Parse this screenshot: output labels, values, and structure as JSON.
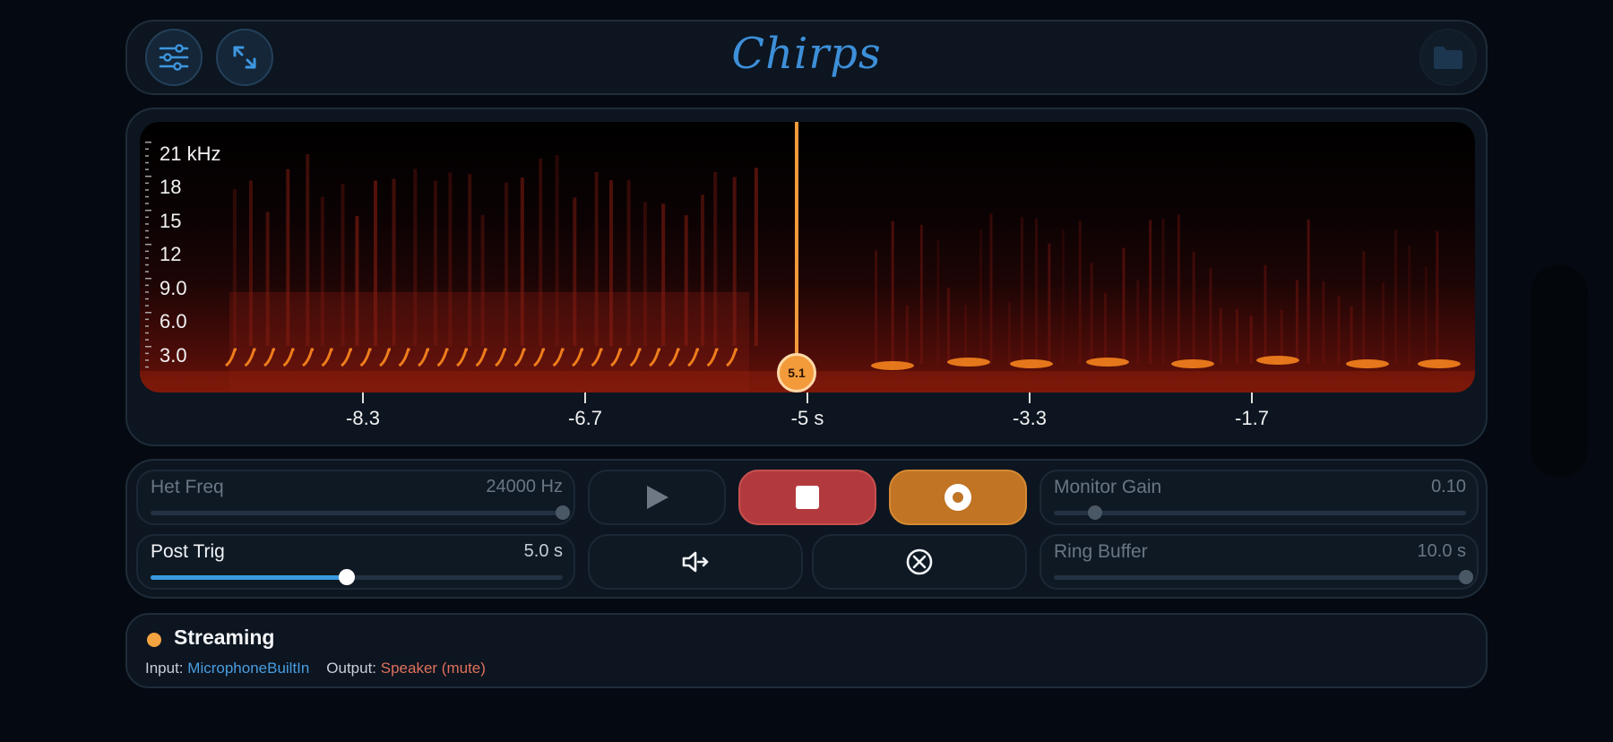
{
  "header": {
    "title": "Chirps",
    "icons": {
      "settings": "sliders-icon",
      "expand": "expand-arrows-icon",
      "folder": "folder-icon"
    }
  },
  "spectrogram": {
    "y_labels": [
      "21 kHz",
      "18",
      "15",
      "12",
      "9.0",
      "6.0",
      "3.0"
    ],
    "x_labels": [
      "-8.3",
      "-6.7",
      "-5 s",
      "-3.3",
      "-1.7"
    ],
    "cursor_value": "5.1",
    "colors": {
      "cursor": "#f39a3a",
      "signal": "#ff8a1e"
    }
  },
  "controls": {
    "het_freq": {
      "label": "Het Freq",
      "value": "24000 Hz",
      "level": 1.0
    },
    "post_trig": {
      "label": "Post Trig",
      "value": "5.0 s",
      "level": 0.475
    },
    "monitor_gain": {
      "label": "Monitor Gain",
      "value": "0.10",
      "level": 0.1
    },
    "ring_buffer": {
      "label": "Ring Buffer",
      "value": "10.0 s",
      "level": 1.0
    },
    "buttons": {
      "play": "play-icon",
      "stop": "stop-icon",
      "record": "record-icon",
      "route": "speaker-route-icon",
      "clear": "cancel-circle-icon"
    },
    "colors": {
      "stop": "#b23a3e",
      "record": "#c07424",
      "accent": "#3a9ae0"
    }
  },
  "status": {
    "text": "Streaming",
    "input_label": "Input:",
    "input_value": "MicrophoneBuiltIn",
    "output_label": "Output:",
    "output_value": "Speaker (mute)",
    "dot_color": "#f3a340"
  }
}
